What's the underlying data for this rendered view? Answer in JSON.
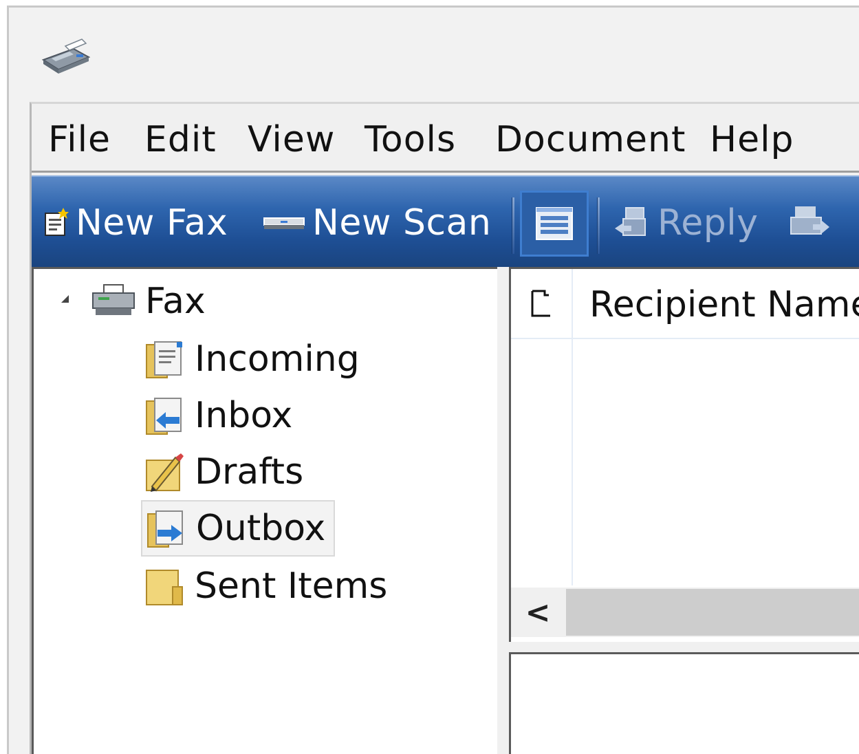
{
  "window": {
    "icon": "fax-machine-icon"
  },
  "menu": {
    "items": [
      "File",
      "Edit",
      "View",
      "Tools",
      "Document",
      "Help"
    ]
  },
  "toolbar": {
    "new_fax": "New Fax",
    "new_scan": "New Scan",
    "reply": "Reply"
  },
  "tree": {
    "root": "Fax",
    "folders": [
      "Incoming",
      "Inbox",
      "Drafts",
      "Outbox",
      "Sent Items"
    ],
    "selected": "Outbox"
  },
  "list": {
    "columns": [
      "Recipient Name"
    ],
    "scroll_left": "<"
  },
  "colors": {
    "toolbar_blue": "#2e65ae",
    "selection_bg": "#f3f3f3"
  }
}
